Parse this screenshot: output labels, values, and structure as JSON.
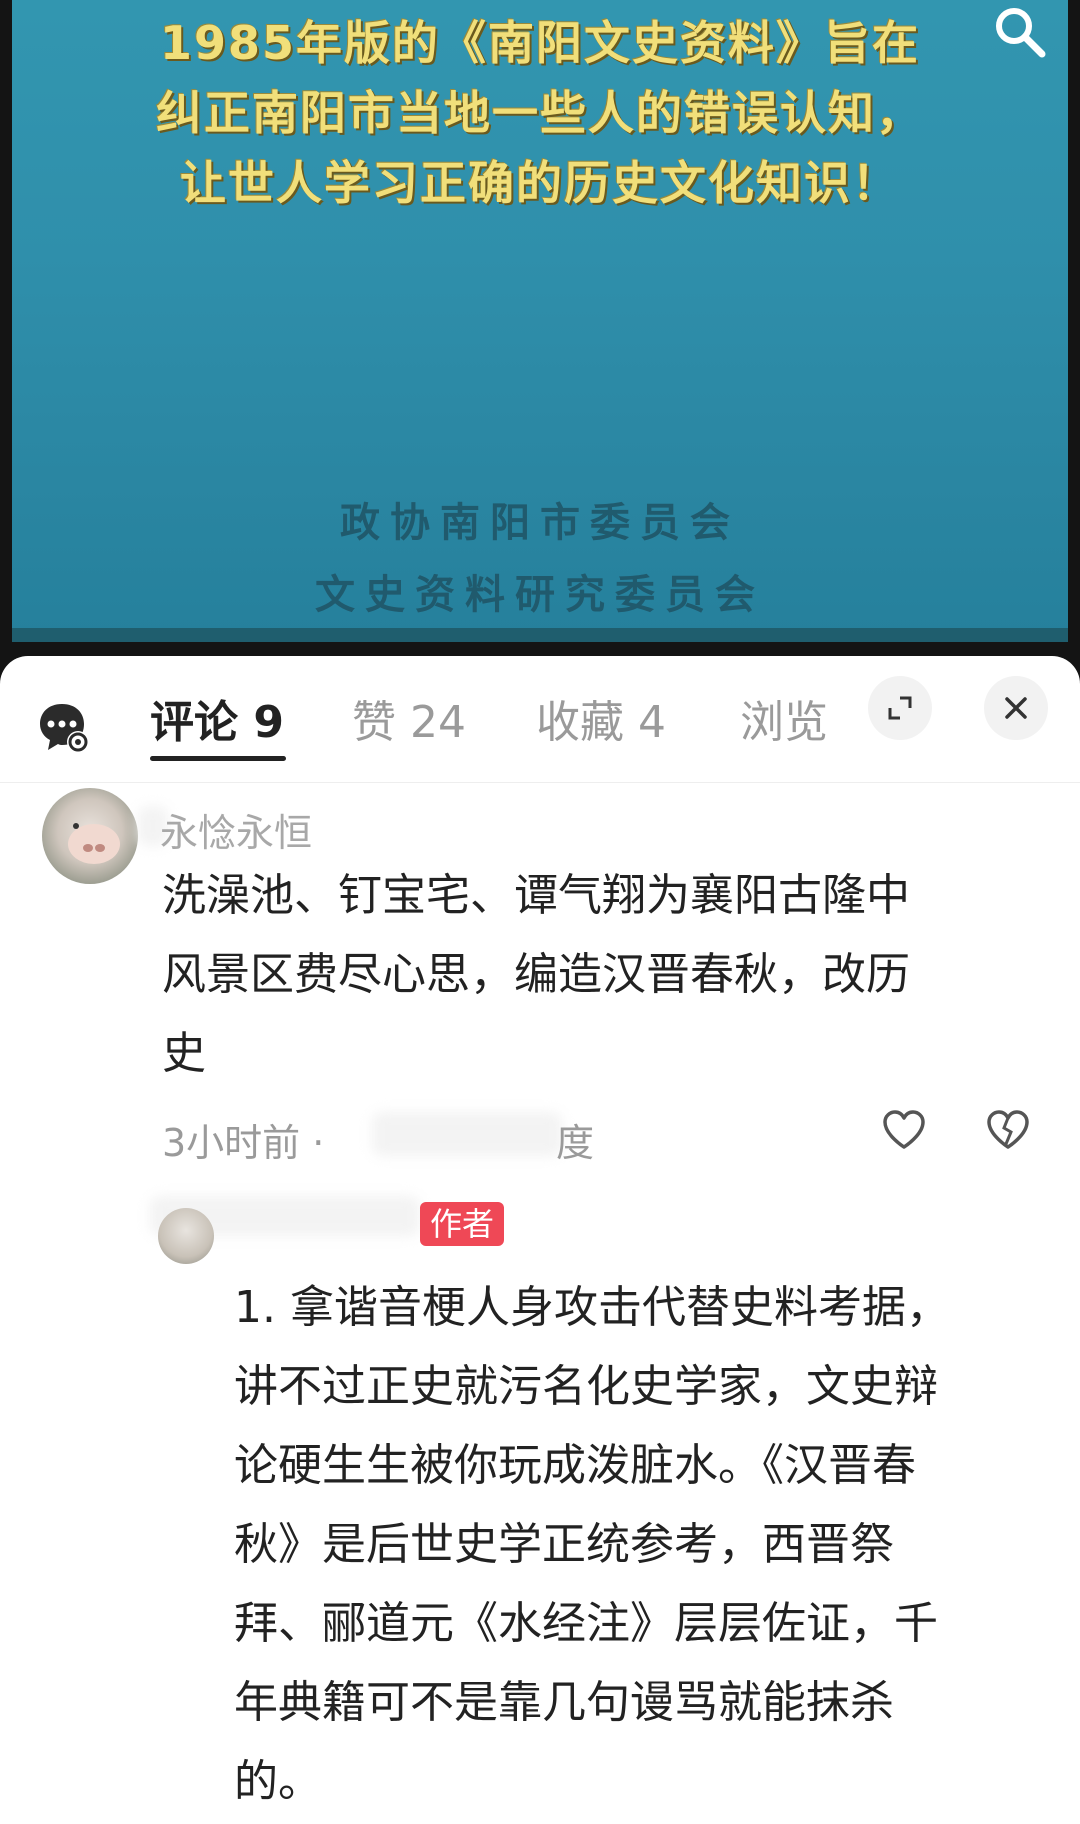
{
  "video": {
    "overlay_lines": [
      "1985年版的《南阳文史资料》旨在",
      "纠正南阳市当地一些人的错误认知，",
      "让世人学习正确的历史文化知识！"
    ],
    "seal_lines": [
      "政协南阳市委员会",
      "文史资料研究委员会"
    ]
  },
  "tabs": [
    {
      "label": "评论 9"
    },
    {
      "label": "赞 24"
    },
    {
      "label": "收藏 4"
    },
    {
      "label": "浏览"
    }
  ],
  "comments": [
    {
      "username": "永惗永恒",
      "text_lines": [
        "洗澡池、钉宝宅、谭气翔为襄阳古隆中",
        "风景区费尽心思，编造汉晋春秋，改历",
        "史"
      ],
      "time": "3小时前 ·",
      "location": "度"
    }
  ],
  "reply": {
    "badge": "作者",
    "text_lines": [
      "1. 拿谐音梗人身攻击代替史料考据，",
      "讲不过正史就污名化史学家，文史辩",
      "论硬生生被你玩成泼脏水。《汉晋春",
      "秋》是后世史学正统参考，西晋祭",
      "拜、郦道元《水经注》层层佐证，千",
      "年典籍可不是靠几句谩骂就能抹杀",
      "的。"
    ]
  },
  "icons": {
    "search": "search-icon",
    "chat": "chat-settings-icon",
    "expand": "expand-icon",
    "close": "close-icon",
    "like": "heart-icon",
    "dislike": "broken-heart-icon"
  },
  "colors": {
    "badge": "#ef4856",
    "overlay_text": "#f1df7a",
    "video_bg": "#2f8fab"
  }
}
